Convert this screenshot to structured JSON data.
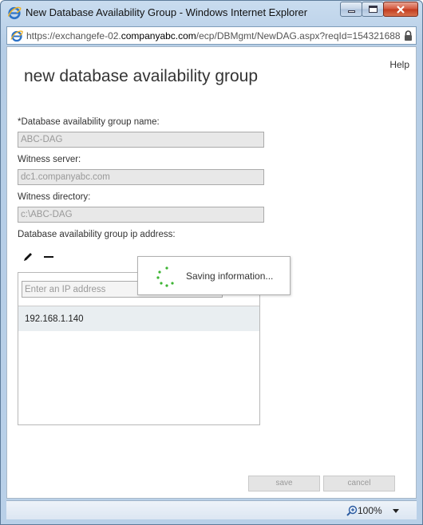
{
  "window": {
    "title": "New Database Availability Group - Windows Internet Explorer",
    "controls": {
      "minimize": "minimize",
      "maximize": "maximize",
      "close": "close"
    }
  },
  "addressbar": {
    "prefix": "https://exchangefe-02.",
    "domain": "companyabc.com",
    "path": "/ecp/DBMgmt/NewDAG.aspx?reqId=154321688",
    "icon": "ie-page-icon",
    "secure_icon": "lock-icon"
  },
  "page": {
    "help": "Help",
    "title": "new database availability group",
    "fields": {
      "dag_name_label": "*Database availability group name:",
      "dag_name_value": "ABC-DAG",
      "witness_server_label": "Witness server:",
      "witness_server_value": "dc1.companyabc.com",
      "witness_dir_label": "Witness directory:",
      "witness_dir_value": "c:\\ABC-DAG",
      "ip_label": "Database availability group ip address:"
    },
    "ip_panel": {
      "placeholder": "Enter an IP address",
      "addresses": [
        "192.168.1.140"
      ]
    },
    "saving": {
      "text": "Saving information..."
    },
    "buttons": {
      "save": "save",
      "cancel": "cancel"
    }
  },
  "statusbar": {
    "zoom": "100%"
  },
  "colors": {
    "spinner": "#3cb432",
    "accent": "#1e5aa8"
  }
}
